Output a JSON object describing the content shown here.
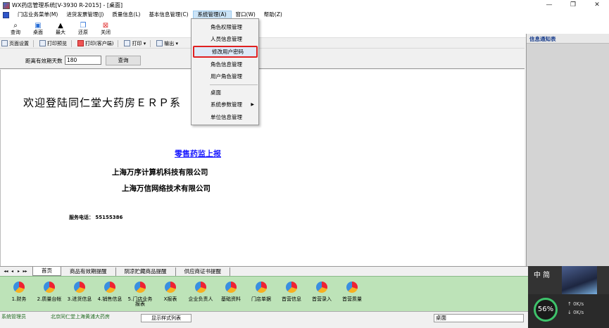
{
  "window": {
    "title": "WX药店管理系统[V-3930 R-2015] - [桌面]",
    "controls": [
      "—",
      "❐",
      "✕"
    ]
  },
  "menubar": {
    "items": [
      "门店业务菜单(M)",
      "进货发票管理(J)",
      "质量信息(L)",
      "基本信息管理(C)",
      "系统管理(A)",
      "窗口(W)",
      "帮助(Z)"
    ]
  },
  "toolbar": {
    "buttons": [
      {
        "label": "查询",
        "icon": "binoculars-icon"
      },
      {
        "label": "桌面",
        "icon": "desktop-icon"
      },
      {
        "label": "最大",
        "icon": "maximize-icon"
      },
      {
        "label": "还原",
        "icon": "restore-icon"
      },
      {
        "label": "关闭",
        "icon": "close-icon"
      }
    ]
  },
  "toolbar2": {
    "page_setup": "页面设置",
    "print_preview": "打印预览",
    "print_client": "打印(客户端)",
    "print": "打印 ▾",
    "export": "输出 ▾"
  },
  "filter": {
    "label": "距离有效期天数",
    "value": "180",
    "query_button": "查询"
  },
  "content": {
    "welcome": "欢迎登陆同仁堂大药房ＥＲＰ系",
    "report_link": "零售药监上报",
    "company1": "上海万序计算机科技有限公司",
    "company2": "上海万信网络技术有限公司",
    "phone": "服务电话： 55155386"
  },
  "right_panel": {
    "header": "信息通知表"
  },
  "tabs": {
    "navs": [
      "◂◂",
      "◂",
      "▸",
      "▸▸"
    ],
    "items": [
      "首页",
      "商品有效期提醒",
      "阴凉贮藏商品提醒",
      "供应商证书提醒"
    ]
  },
  "shortcuts": [
    "1.财务",
    "2.质量台帐",
    "3.进货信息",
    "4.销售信息",
    "5.门店业务报表",
    "X报表",
    "企业负责人",
    "基础资料",
    "门店单据",
    "首营信息",
    "首营录入",
    "首营质量"
  ],
  "status": {
    "admin": "系统管理员",
    "store": "北京同仁堂上海黄浦大药房",
    "style_select": "显示样式列表",
    "location": "桌面"
  },
  "widget": {
    "char": "中 简",
    "percent": "56%",
    "up": "0K/s",
    "down": "0K/s"
  },
  "dropdown": {
    "items": [
      "角色权限管理",
      "人员信息管理",
      "修改用户密码",
      "角色信息管理",
      "用户角色管理",
      "桌面",
      "系统参数管理",
      "单位信息管理"
    ],
    "highlighted_index": 2
  }
}
